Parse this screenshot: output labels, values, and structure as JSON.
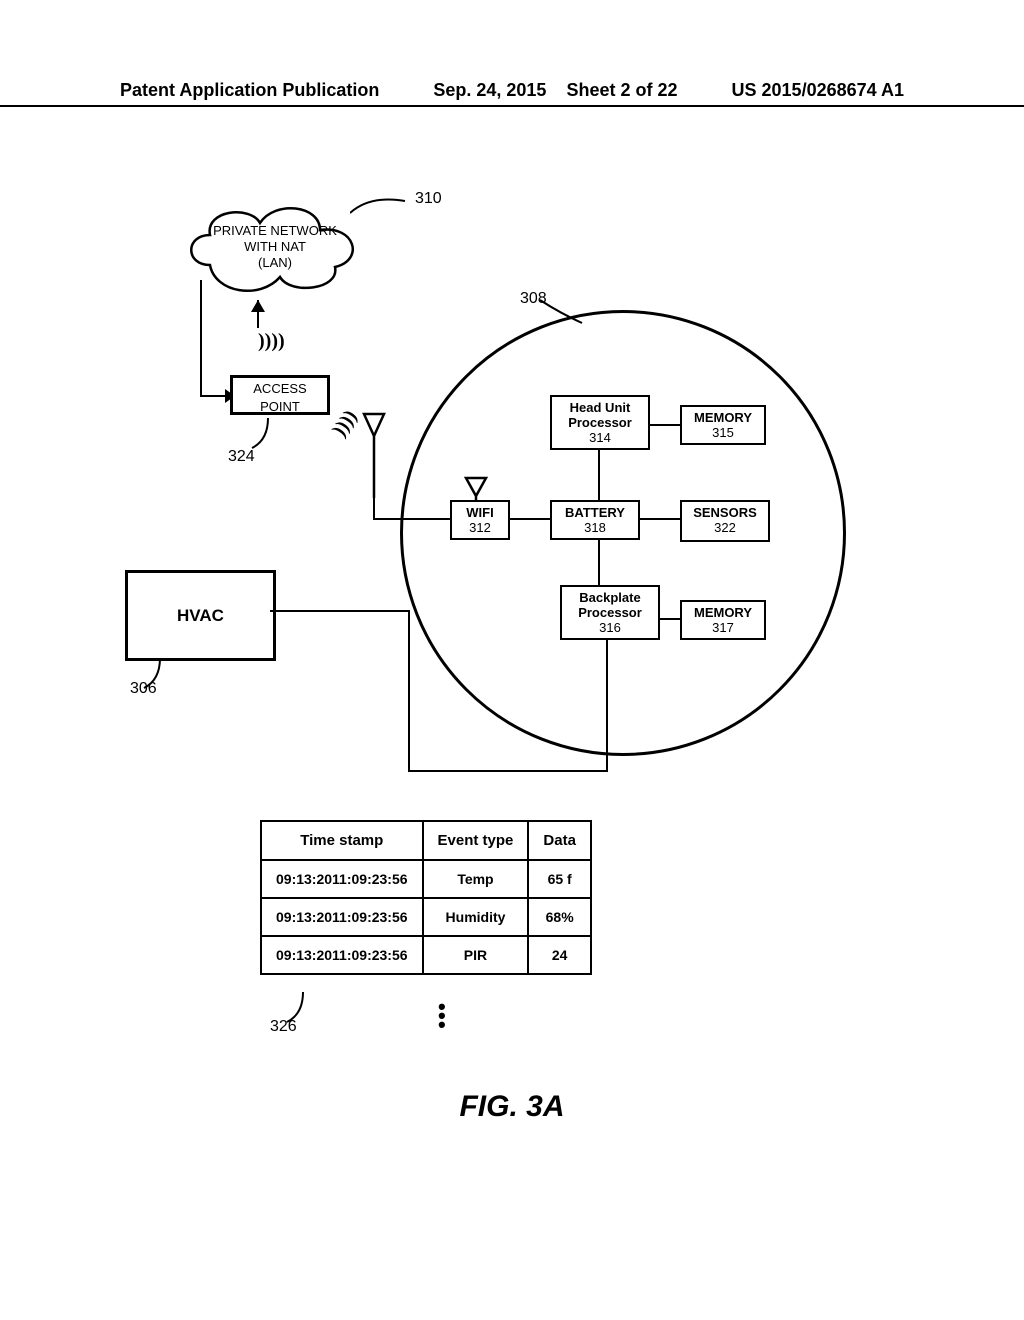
{
  "header": {
    "publication": "Patent Application Publication",
    "date": "Sep. 24, 2015",
    "sheet": "Sheet 2 of 22",
    "pubno": "US 2015/0268674 A1"
  },
  "cloud": {
    "line1": "PRIVATE NETWORK",
    "line2": "WITH NAT",
    "line3": "(LAN)",
    "ref": "310"
  },
  "access_point": {
    "line1": "ACCESS",
    "line2": "POINT",
    "ref": "324",
    "waves": "))))"
  },
  "device_circle": {
    "ref": "308"
  },
  "blocks": {
    "hu": {
      "l1": "Head Unit",
      "l2": "Processor",
      "l3": "314"
    },
    "mem1": {
      "l1": "MEMORY",
      "l2": "315"
    },
    "wifi": {
      "l1": "WIFI",
      "l2": "312"
    },
    "batt": {
      "l1": "BATTERY",
      "l2": "318"
    },
    "sensors": {
      "l1": "SENSORS",
      "l2": "322"
    },
    "bp": {
      "l1": "Backplate",
      "l2": "Processor",
      "l3": "316"
    },
    "mem2": {
      "l1": "MEMORY",
      "l2": "317"
    }
  },
  "wifi_waves": "))))",
  "hvac": {
    "label": "HVAC",
    "ref": "306"
  },
  "table": {
    "headers": [
      "Time stamp",
      "Event type",
      "Data"
    ],
    "rows": [
      [
        "09:13:2011:09:23:56",
        "Temp",
        "65 f"
      ],
      [
        "09:13:2011:09:23:56",
        "Humidity",
        "68%"
      ],
      [
        "09:13:2011:09:23:56",
        "PIR",
        "24"
      ]
    ],
    "ref": "326"
  },
  "figure_label": "FIG. 3A"
}
